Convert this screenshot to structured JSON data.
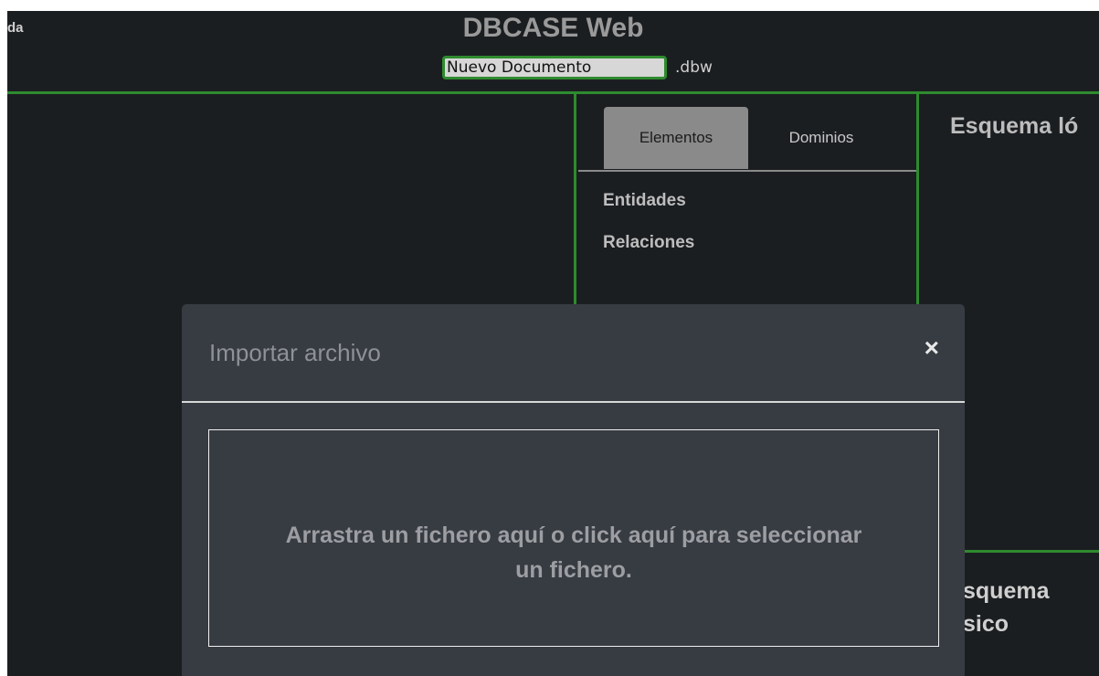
{
  "header": {
    "menu_fragment": "da",
    "app_title": "DBCASE Web",
    "document_name": "Nuevo Documento",
    "document_extension": ".dbw"
  },
  "palette": {
    "panel_border": "#2e8b2e",
    "background": "#1b1e21",
    "modal_background": "#373b42"
  },
  "tabs": [
    {
      "label": "Elementos",
      "active": true
    },
    {
      "label": "Dominios",
      "active": false
    }
  ],
  "elements_list": [
    {
      "label": "Entidades"
    },
    {
      "label": "Relaciones"
    }
  ],
  "panels": {
    "logical_schema_title": "Esquema ló",
    "physical_schema_line1": "squema",
    "physical_schema_line2": "sico"
  },
  "modal": {
    "title": "Importar archivo",
    "close_icon": "close-icon",
    "close_glyph": "×",
    "dropzone_text": "Arrastra un fichero aquí o click aquí para seleccionar un fichero."
  }
}
